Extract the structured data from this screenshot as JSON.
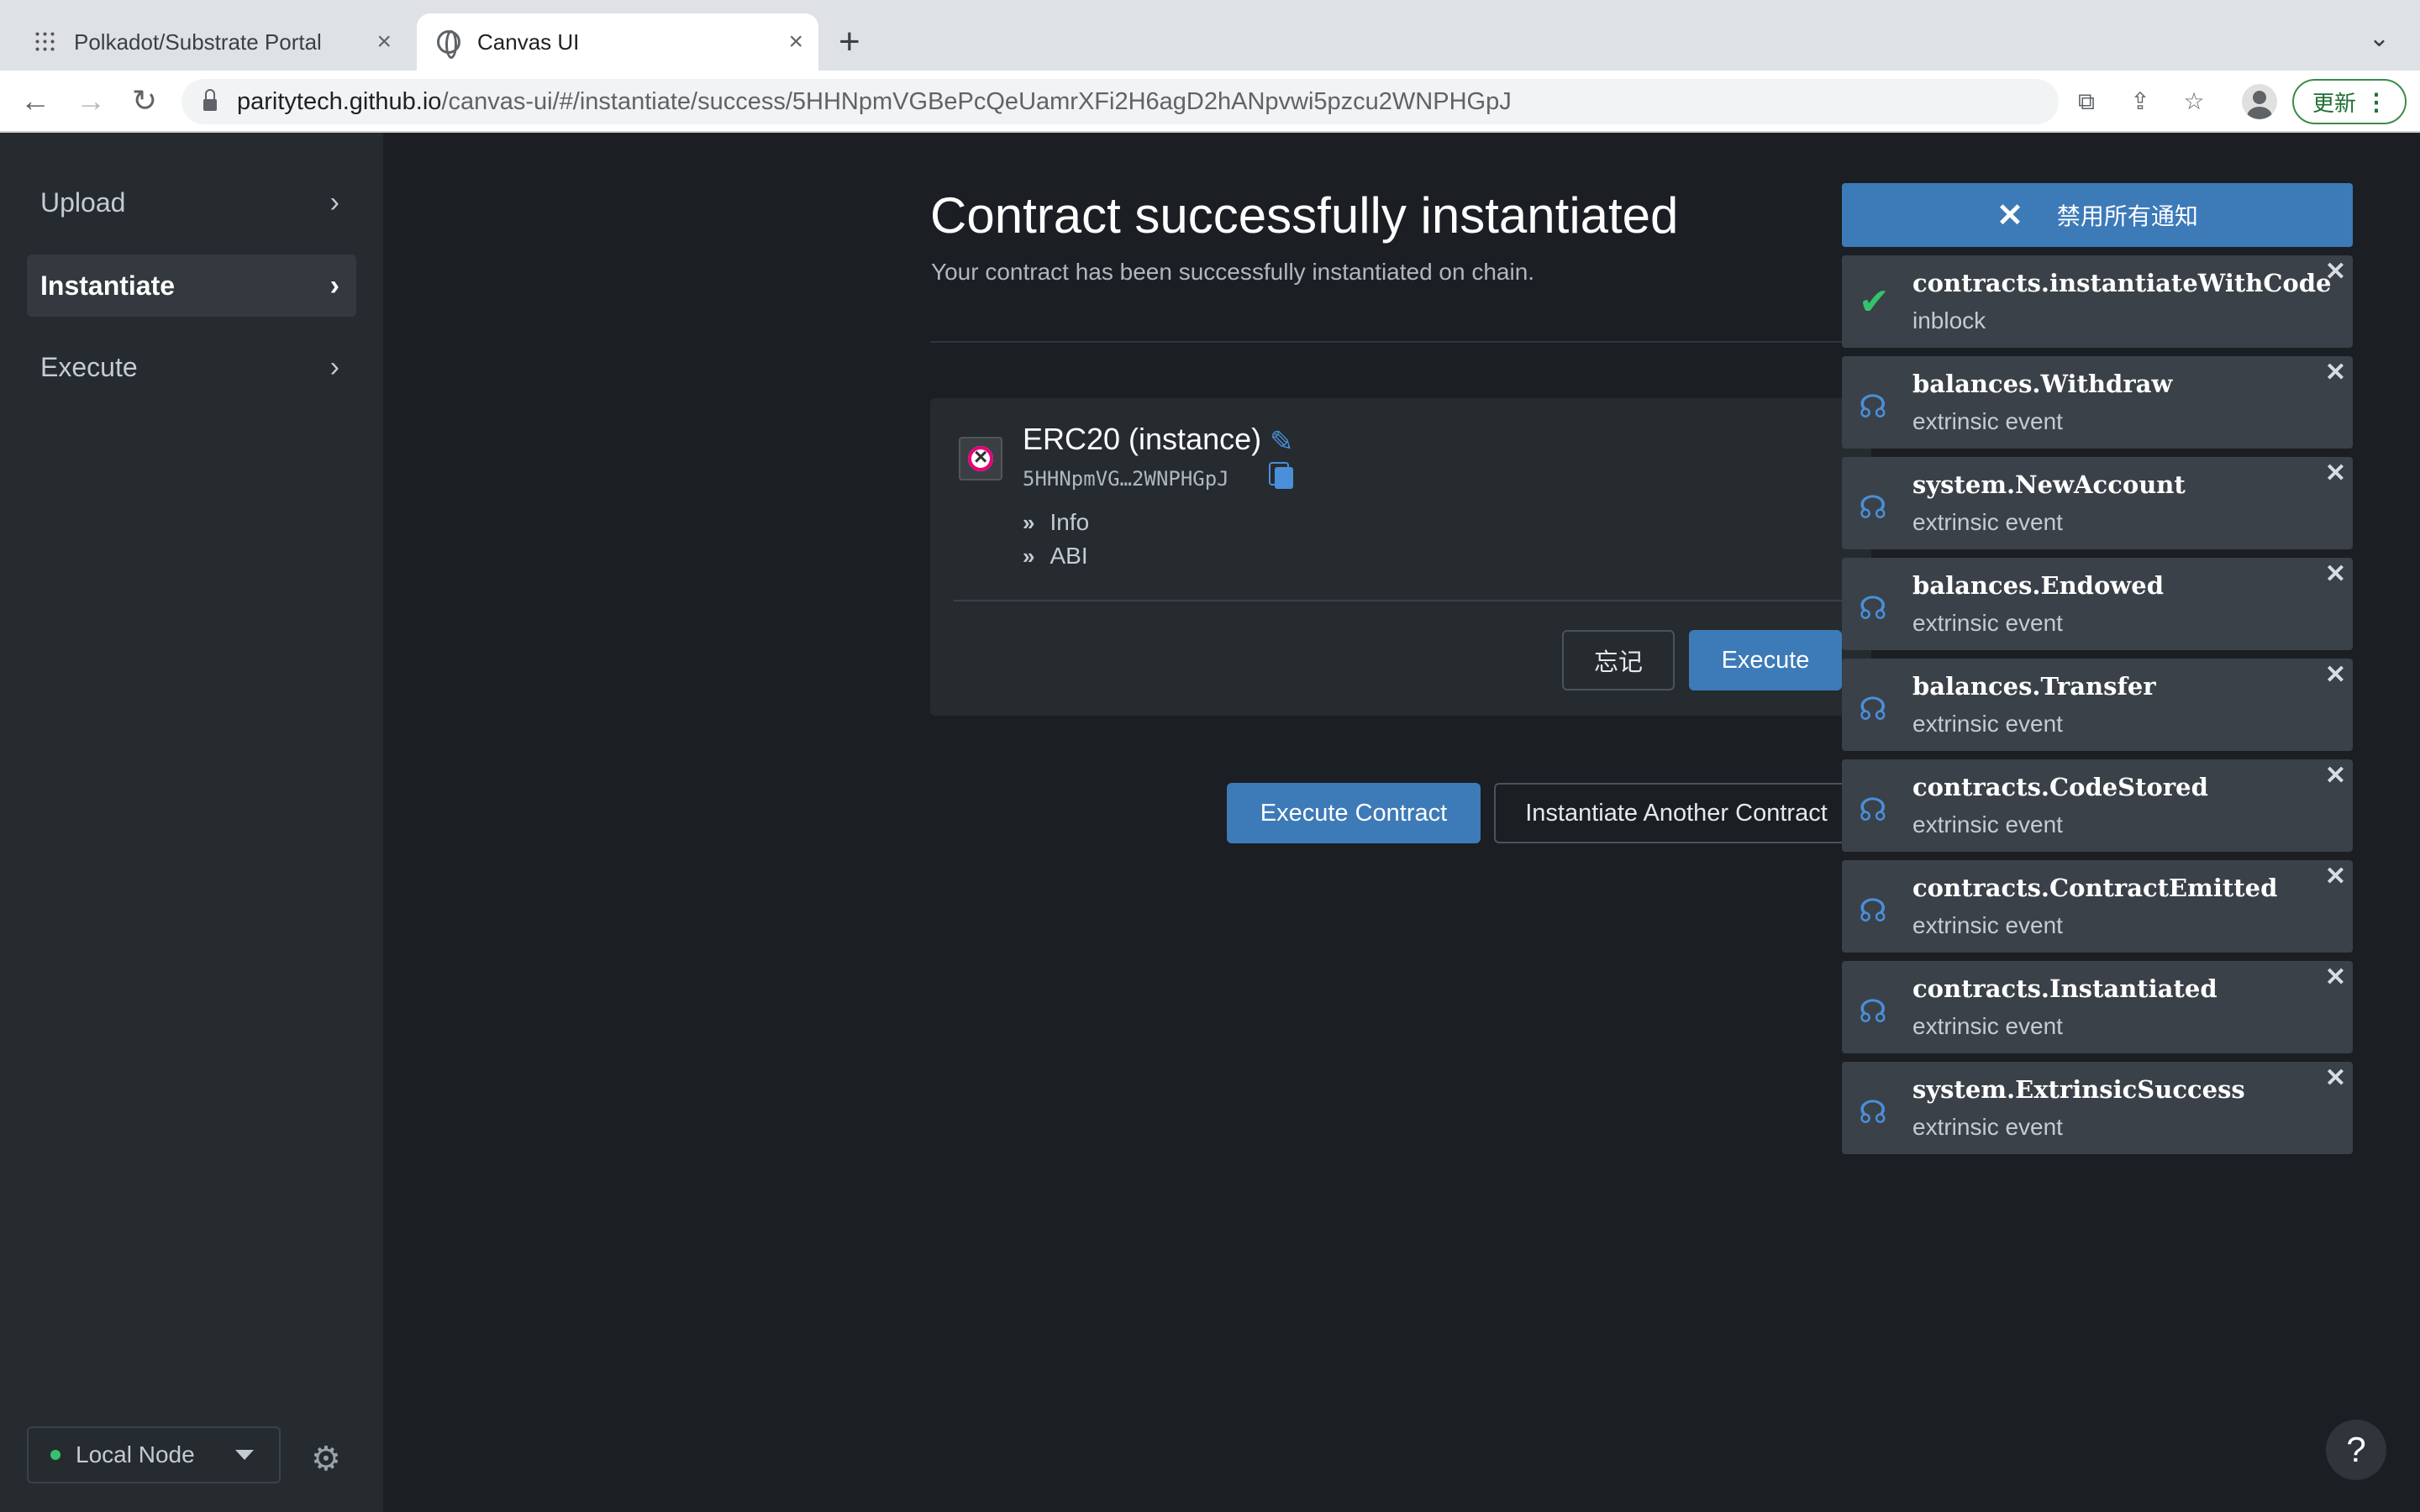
{
  "browser": {
    "tabs": [
      {
        "title": "Polkadot/Substrate Portal",
        "active": false
      },
      {
        "title": "Canvas UI",
        "active": true
      }
    ],
    "url_host": "paritytech.github.io",
    "url_path": "/canvas-ui/#/instantiate/success/5HHNpmVGBePcQeUamrXFi2H6agD2hANpvwi5pzcu2WNPHGpJ",
    "update_label": "更新"
  },
  "sidebar": {
    "items": [
      {
        "label": "Upload",
        "active": false
      },
      {
        "label": "Instantiate",
        "active": true
      },
      {
        "label": "Execute",
        "active": false
      }
    ],
    "node_label": "Local Node",
    "node_status_color": "#36c26c"
  },
  "main": {
    "title": "Contract successfully instantiated",
    "subtitle": "Your contract has been successfully instantiated on chain.",
    "contract": {
      "name": "ERC20 (instance)",
      "address": "5HHNpmVG…2WNPHGpJ",
      "expanders": [
        "Info",
        "ABI"
      ],
      "forget_label": "忘记",
      "execute_label": "Execute"
    },
    "execute_contract_label": "Execute Contract",
    "instantiate_another_label": "Instantiate Another Contract"
  },
  "notifications": {
    "dismiss_all_label": "禁用所有通知",
    "items": [
      {
        "title": "contracts.instantiateWithCode",
        "subtitle": "inblock",
        "status": "success"
      },
      {
        "title": "balances.Withdraw",
        "subtitle": "extrinsic event",
        "status": "event"
      },
      {
        "title": "system.NewAccount",
        "subtitle": "extrinsic event",
        "status": "event"
      },
      {
        "title": "balances.Endowed",
        "subtitle": "extrinsic event",
        "status": "event"
      },
      {
        "title": "balances.Transfer",
        "subtitle": "extrinsic event",
        "status": "event"
      },
      {
        "title": "contracts.CodeStored",
        "subtitle": "extrinsic event",
        "status": "event"
      },
      {
        "title": "contracts.ContractEmitted",
        "subtitle": "extrinsic event",
        "status": "event"
      },
      {
        "title": "contracts.Instantiated",
        "subtitle": "extrinsic event",
        "status": "event"
      },
      {
        "title": "system.ExtrinsicSuccess",
        "subtitle": "extrinsic event",
        "status": "event"
      }
    ]
  },
  "help_label": "?",
  "colors": {
    "accent": "#3d7ab8",
    "success": "#36c26c",
    "background": "#1b1f23"
  }
}
